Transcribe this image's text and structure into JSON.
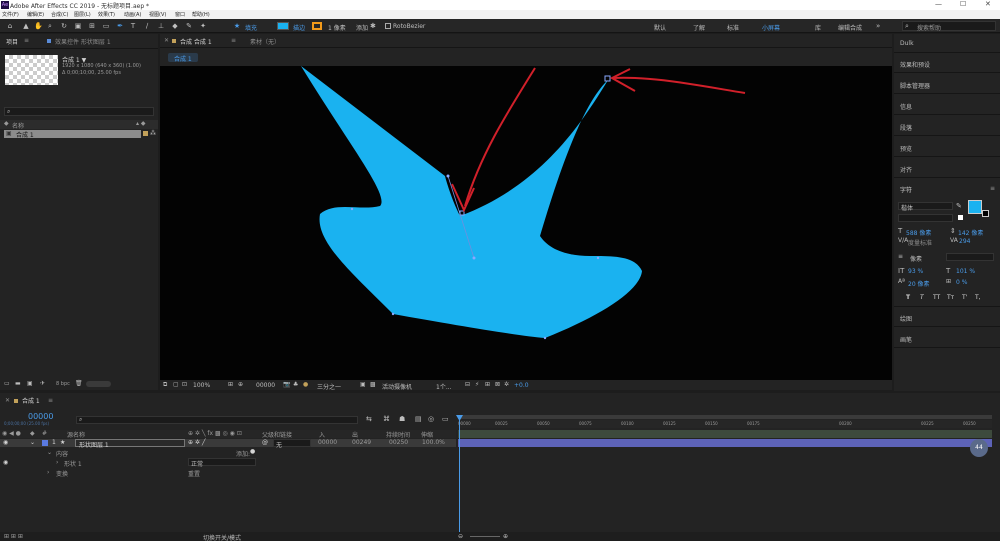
{
  "window": {
    "title": "Adobe After Effects CC 2019 - 无标题项目.aep *",
    "minimize": "—",
    "maximize": "☐",
    "close": "✕"
  },
  "menu": [
    "文件(F)",
    "编辑(E)",
    "合成(C)",
    "图层(L)",
    "效果(T)",
    "动画(A)",
    "视图(V)",
    "窗口",
    "帮助(H)"
  ],
  "toolbar": {
    "fill_label": "填充",
    "stroke_label": "描边",
    "stroke_width": "1 像素",
    "add_label": "添加",
    "rotobezier": "RotoBezier",
    "workspaces": [
      "默认",
      "了解",
      "标准",
      "小屏幕",
      "库",
      "编辑合成"
    ],
    "search_placeholder": "搜索帮助",
    "fill_color": "#1ab2f0",
    "stroke_color": "#f29a1a"
  },
  "project_panel": {
    "tab_project": "项目",
    "tab_effects": "效果控件 形状图层 1",
    "comp_name": "合成 1 ▼",
    "comp_info_1": "1920 x 1080 (640 x 360) (1.00)",
    "comp_info_2": "Δ 0;00;10;00, 25.00 fps",
    "col_name": "名称",
    "item_name": "合成 1",
    "bpc": "8 bpc"
  },
  "comp_viewer": {
    "tab_comp": "合成 合成 1",
    "tab_footage": "素材（无）",
    "breadcrumb": "合成 1",
    "zoom": "100%",
    "timecode": "00000",
    "resolution": "三分之一",
    "camera": "活动摄像机",
    "views": "1个...",
    "exposure": "+0.0"
  },
  "right_panel": {
    "items": [
      "Dulk",
      "效果和预设",
      "脚本管理器",
      "信息",
      "段落",
      "预览",
      "对齐"
    ],
    "character_title": "字符",
    "font": "楷体",
    "font_size": "588 像素",
    "leading": "142 像素",
    "tracking_label": "度量标准",
    "tracking_value": "294",
    "stroke_px": "像素",
    "vert_scale": "93 %",
    "horiz_scale": "101 %",
    "baseline": "20 像素",
    "tsume": "0 %",
    "type_buttons": [
      "T",
      "T",
      "TT",
      "Tт",
      "T'",
      "T,"
    ],
    "lower_items": [
      "绘图",
      "画笔"
    ],
    "text_color": "#1ab2f0"
  },
  "timeline": {
    "tab": "合成 1",
    "timecode": "00000",
    "timecode_sub": "0;00;00;00 (25.00 fps)",
    "col_source": "源名称",
    "col_parent": "父级和链接",
    "col_in": "入",
    "col_out": "出",
    "col_duration": "持续时间",
    "col_stretch": "伸缩",
    "layer_number": "1",
    "layer_name": "形状图层 1",
    "parent_value": "无",
    "in_value": "00000",
    "out_value": "00249",
    "duration_value": "00250",
    "stretch_value": "100.0%",
    "contents_label": "内容",
    "add_label": "添加:",
    "shape_label": "形状 1",
    "blend_mode": "正常",
    "transform_label": "变换",
    "reset_label": "重置",
    "ruler_ticks": [
      "00000",
      "00025",
      "00050",
      "00075",
      "00100",
      "00125",
      "00150",
      "00175",
      "00200",
      "00225",
      "00250"
    ],
    "toggle_label": "切换开关/模式"
  }
}
